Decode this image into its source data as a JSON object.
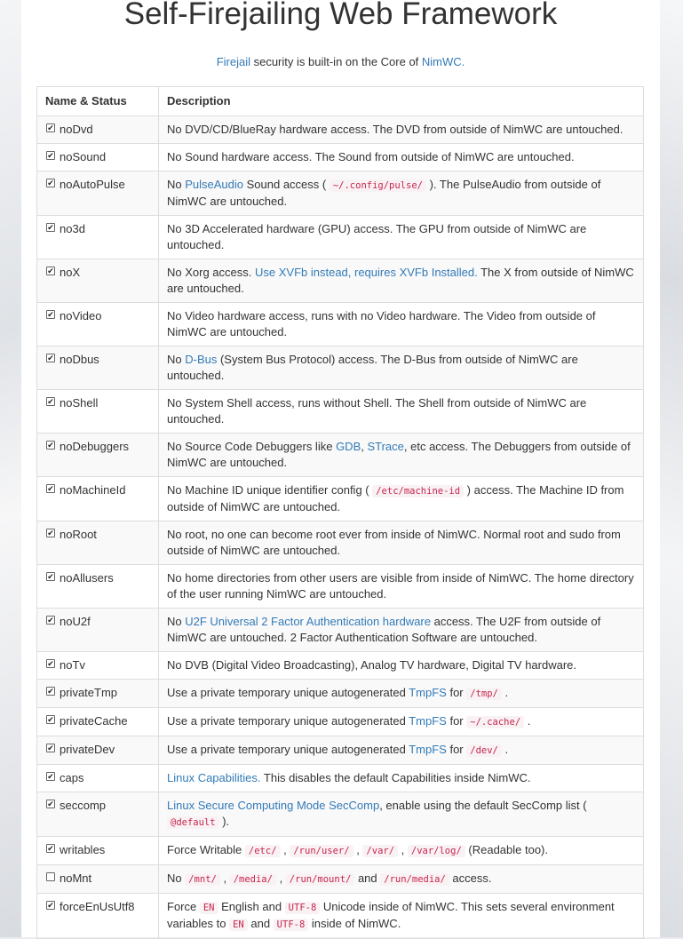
{
  "page": {
    "title": "Self-Firejailing Web Framework",
    "subtitle": {
      "firejail_link": "Firejail",
      "middle": " security is built-in on the Core of ",
      "nimwc_link": "NimWC."
    }
  },
  "table": {
    "headers": [
      "Name & Status",
      "Description"
    ],
    "rows": [
      {
        "name": "noDvd",
        "checked": true,
        "desc": [
          {
            "t": "No DVD/CD/BlueRay hardware access. The DVD from outside of NimWC are untouched."
          }
        ]
      },
      {
        "name": "noSound",
        "checked": true,
        "desc": [
          {
            "t": "No Sound hardware access. The Sound from outside of NimWC are untouched."
          }
        ]
      },
      {
        "name": "noAutoPulse",
        "checked": true,
        "desc": [
          {
            "t": "No "
          },
          {
            "l": "PulseAudio"
          },
          {
            "t": " Sound access ( "
          },
          {
            "c": "~/.config/pulse/"
          },
          {
            "t": " ). The PulseAudio from outside of NimWC are untouched."
          }
        ]
      },
      {
        "name": "no3d",
        "checked": true,
        "desc": [
          {
            "t": "No 3D Accelerated hardware (GPU) access. The GPU from outside of NimWC are untouched."
          }
        ]
      },
      {
        "name": "noX",
        "checked": true,
        "desc": [
          {
            "t": "No Xorg access. "
          },
          {
            "l": "Use XVFb instead, requires XVFb Installed."
          },
          {
            "t": " The X from outside of NimWC are untouched."
          }
        ]
      },
      {
        "name": "noVideo",
        "checked": true,
        "desc": [
          {
            "t": "No Video hardware access, runs with no Video hardware. The Video from outside of NimWC are untouched."
          }
        ]
      },
      {
        "name": "noDbus",
        "checked": true,
        "desc": [
          {
            "t": "No "
          },
          {
            "l": "D-Bus"
          },
          {
            "t": " (System Bus Protocol) access. The D-Bus from outside of NimWC are untouched."
          }
        ]
      },
      {
        "name": "noShell",
        "checked": true,
        "desc": [
          {
            "t": "No System Shell access, runs without Shell. The Shell from outside of NimWC are untouched."
          }
        ]
      },
      {
        "name": "noDebuggers",
        "checked": true,
        "desc": [
          {
            "t": "No Source Code Debuggers like "
          },
          {
            "l": "GDB"
          },
          {
            "t": ", "
          },
          {
            "l": "STrace"
          },
          {
            "t": ", etc access. The Debuggers from outside of NimWC are untouched."
          }
        ]
      },
      {
        "name": "noMachineId",
        "checked": true,
        "desc": [
          {
            "t": "No Machine ID unique identifier config ( "
          },
          {
            "c": "/etc/machine-id"
          },
          {
            "t": " ) access. The Machine ID from outside of NimWC are untouched."
          }
        ]
      },
      {
        "name": "noRoot",
        "checked": true,
        "desc": [
          {
            "t": "No root, no one can become root ever from inside of NimWC. Normal root and sudo from outside of NimWC are untouched."
          }
        ]
      },
      {
        "name": "noAllusers",
        "checked": true,
        "desc": [
          {
            "t": "No home directories from other users are visible from inside of NimWC. The home directory of the user running NimWC are untouched."
          }
        ]
      },
      {
        "name": "noU2f",
        "checked": true,
        "desc": [
          {
            "t": "No "
          },
          {
            "l": "U2F Universal 2 Factor Authentication hardware"
          },
          {
            "t": " access. The U2F from outside of NimWC are untouched. 2 Factor Authentication Software are untouched."
          }
        ]
      },
      {
        "name": "noTv",
        "checked": true,
        "desc": [
          {
            "t": "No DVB (Digital Video Broadcasting), Analog TV hardware, Digital TV hardware."
          }
        ]
      },
      {
        "name": "privateTmp",
        "checked": true,
        "desc": [
          {
            "t": "Use a private temporary unique autogenerated "
          },
          {
            "l": "TmpFS"
          },
          {
            "t": " for "
          },
          {
            "c": "/tmp/"
          },
          {
            "t": " ."
          }
        ]
      },
      {
        "name": "privateCache",
        "checked": true,
        "desc": [
          {
            "t": "Use a private temporary unique autogenerated "
          },
          {
            "l": "TmpFS"
          },
          {
            "t": " for "
          },
          {
            "c": "~/.cache/"
          },
          {
            "t": " ."
          }
        ]
      },
      {
        "name": "privateDev",
        "checked": true,
        "desc": [
          {
            "t": "Use a private temporary unique autogenerated "
          },
          {
            "l": "TmpFS"
          },
          {
            "t": " for "
          },
          {
            "c": "/dev/"
          },
          {
            "t": " ."
          }
        ]
      },
      {
        "name": "caps",
        "checked": true,
        "desc": [
          {
            "l": "Linux Capabilities."
          },
          {
            "t": " This disables the default Capabilities inside NimWC."
          }
        ]
      },
      {
        "name": "seccomp",
        "checked": true,
        "desc": [
          {
            "l": "Linux Secure Computing Mode SecComp"
          },
          {
            "t": ", enable using the default SecComp list ( "
          },
          {
            "c": "@default"
          },
          {
            "t": " )."
          }
        ]
      },
      {
        "name": "writables",
        "checked": true,
        "desc": [
          {
            "t": "Force Writable "
          },
          {
            "c": "/etc/"
          },
          {
            "t": " , "
          },
          {
            "c": "/run/user/"
          },
          {
            "t": " , "
          },
          {
            "c": "/var/"
          },
          {
            "t": " , "
          },
          {
            "c": "/var/log/"
          },
          {
            "t": " (Readable too)."
          }
        ]
      },
      {
        "name": "noMnt",
        "checked": false,
        "desc": [
          {
            "t": "No "
          },
          {
            "c": "/mnt/"
          },
          {
            "t": " , "
          },
          {
            "c": "/media/"
          },
          {
            "t": " , "
          },
          {
            "c": "/run/mount/"
          },
          {
            "t": " and "
          },
          {
            "c": "/run/media/"
          },
          {
            "t": " access."
          }
        ]
      },
      {
        "name": "forceEnUsUtf8",
        "checked": true,
        "desc": [
          {
            "t": "Force "
          },
          {
            "c": "EN"
          },
          {
            "t": " English and "
          },
          {
            "c": "UTF-8"
          },
          {
            "t": " Unicode inside of NimWC. This sets several environment variables to "
          },
          {
            "c": "EN"
          },
          {
            "t": " and "
          },
          {
            "c": "UTF-8"
          },
          {
            "t": " inside of NimWC."
          }
        ]
      }
    ]
  },
  "colors": {
    "link": "#337ab7",
    "code_text": "#c7254e",
    "code_bg": "#f9f2f4",
    "stripe": "#f9f9f9",
    "border": "#dddddd"
  },
  "icons": {
    "checkbox_checked": "✔"
  }
}
